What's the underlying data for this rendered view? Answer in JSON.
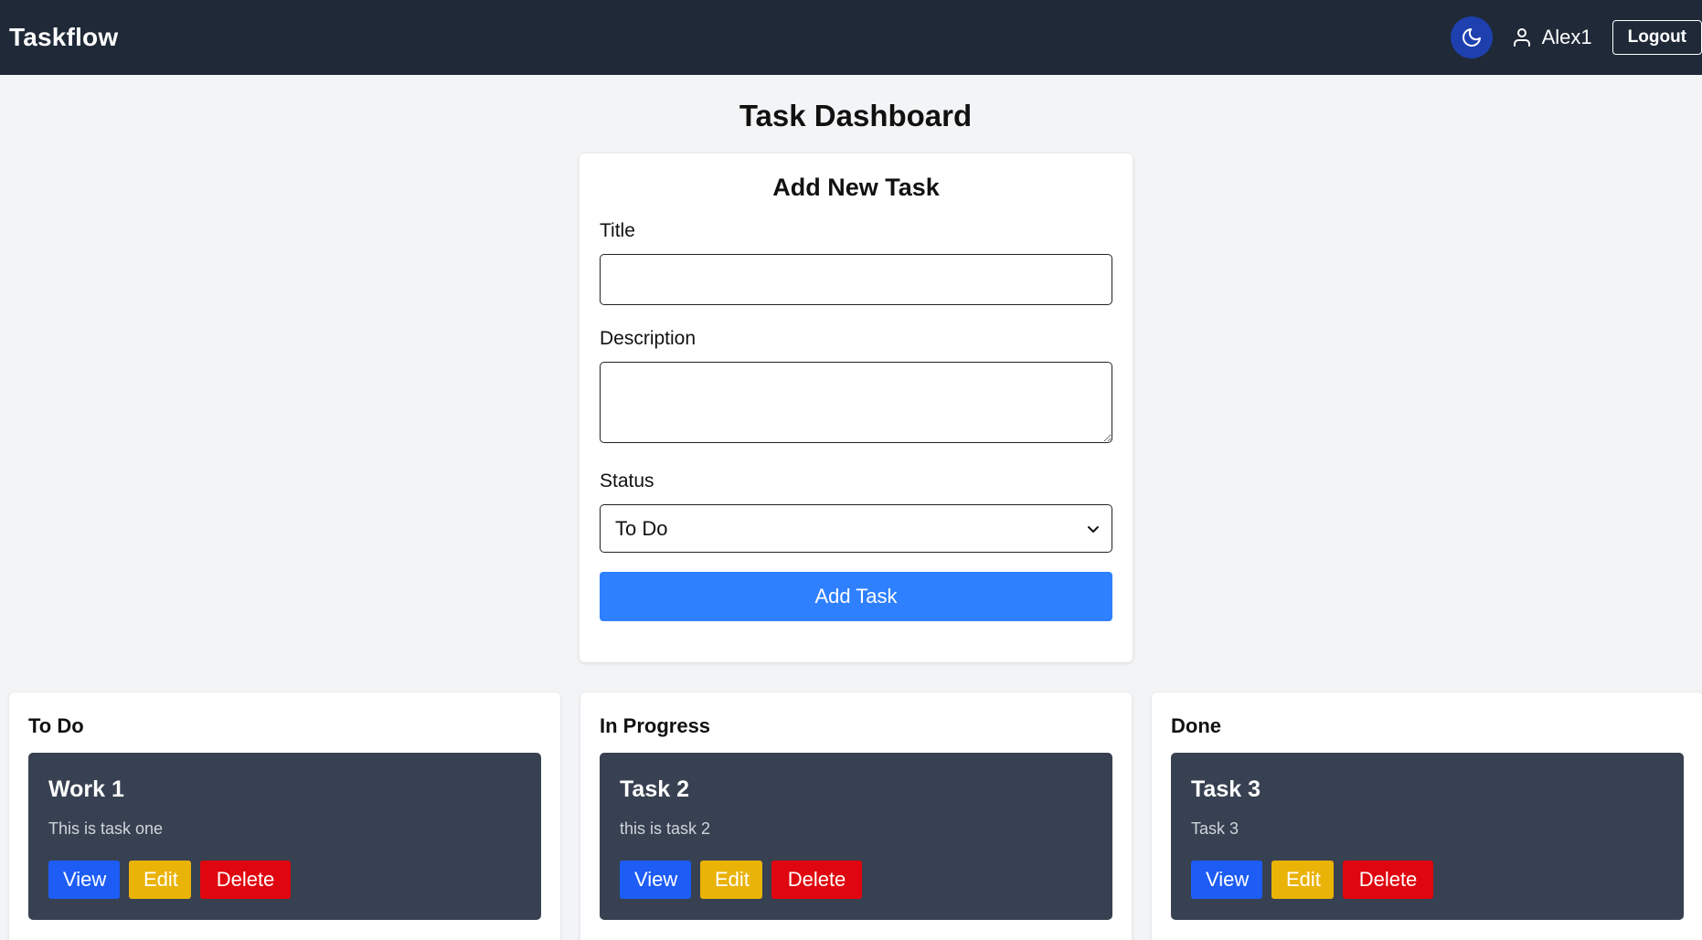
{
  "navbar": {
    "brand": "Taskflow",
    "username": "Alex1",
    "logout_label": "Logout"
  },
  "page": {
    "title": "Task Dashboard"
  },
  "form": {
    "title": "Add New Task",
    "title_label": "Title",
    "title_value": "",
    "description_label": "Description",
    "description_value": "",
    "status_label": "Status",
    "status_value": "To Do",
    "submit_label": "Add Task"
  },
  "columns": [
    {
      "title": "To Do",
      "tasks": [
        {
          "title": "Work 1",
          "description": "This is task one",
          "view": "View",
          "edit": "Edit",
          "delete": "Delete"
        }
      ]
    },
    {
      "title": "In Progress",
      "tasks": [
        {
          "title": "Task 2",
          "description": "this is task 2",
          "view": "View",
          "edit": "Edit",
          "delete": "Delete"
        }
      ]
    },
    {
      "title": "Done",
      "tasks": [
        {
          "title": "Task 3",
          "description": "Task 3",
          "view": "View",
          "edit": "Edit",
          "delete": "Delete"
        }
      ]
    }
  ],
  "icons": {
    "theme_toggle": "moon-icon",
    "user": "user-icon",
    "select": "chevron-down-icon"
  },
  "colors": {
    "navbar": "#1f2937",
    "primary": "#2f80ff",
    "view": "#1d5cf5",
    "edit": "#eab308",
    "delete": "#e0060f",
    "task_card": "#374151"
  }
}
